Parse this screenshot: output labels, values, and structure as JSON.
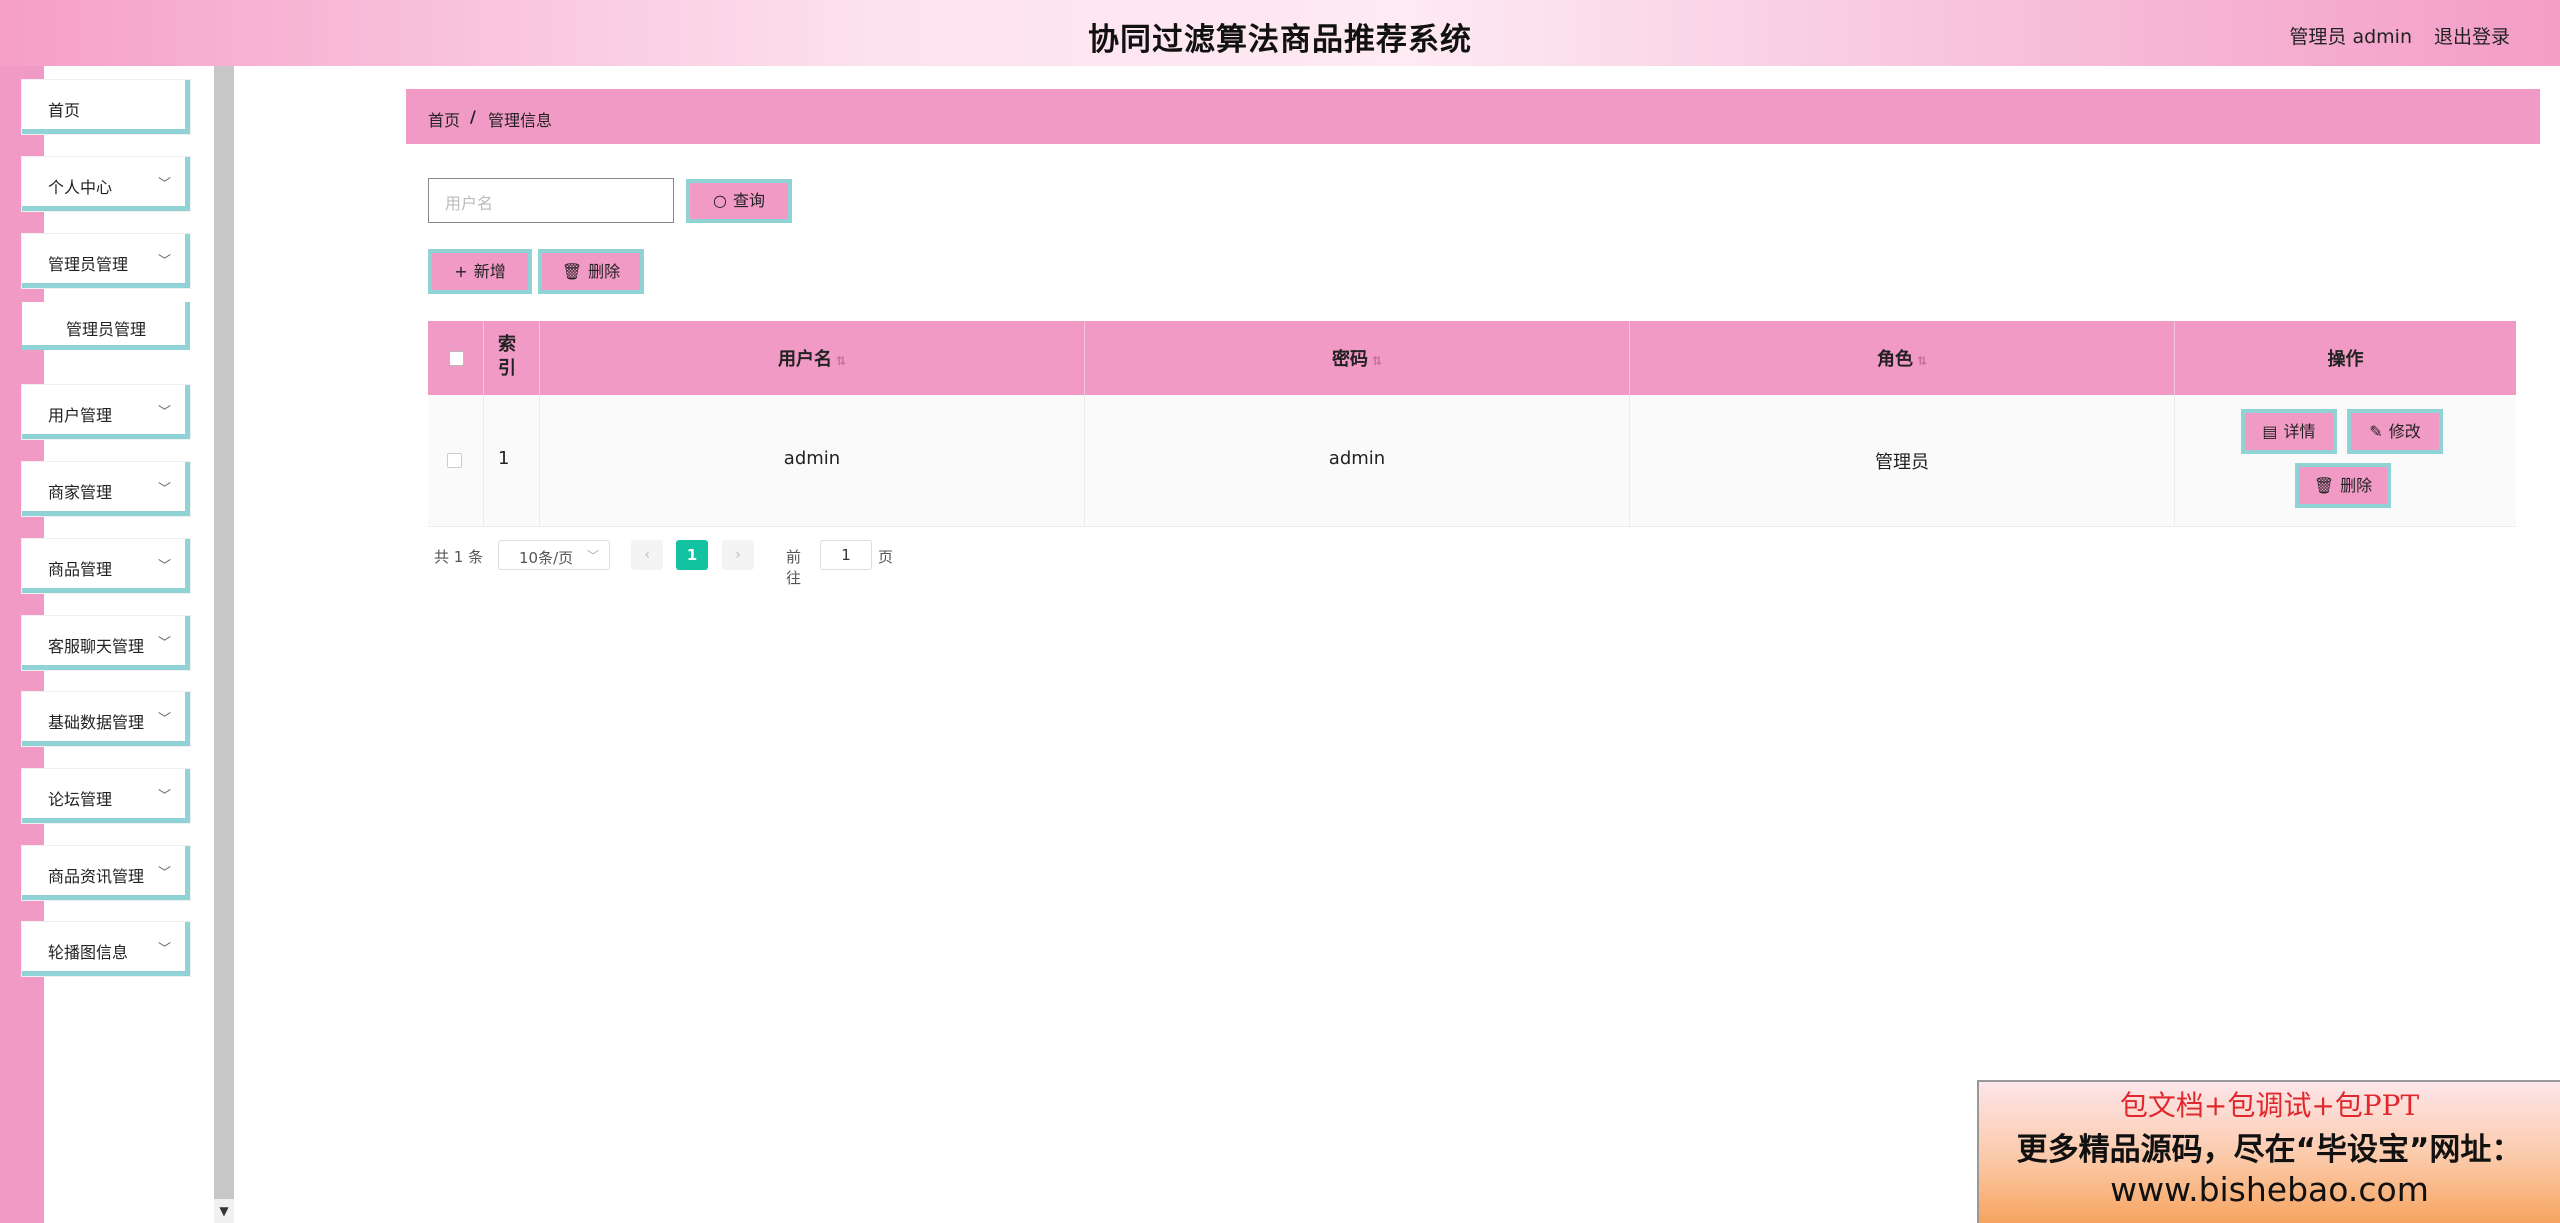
{
  "header": {
    "title": "协同过滤算法商品推荐系统",
    "user_label": "管理员 admin",
    "logout_label": "退出登录"
  },
  "sidebar": {
    "items": [
      {
        "label": "首页"
      },
      {
        "label": "个人中心"
      },
      {
        "label": "管理员管理"
      },
      {
        "label": "管理员管理"
      },
      {
        "label": "用户管理"
      },
      {
        "label": "商家管理"
      },
      {
        "label": "商品管理"
      },
      {
        "label": "客服聊天管理"
      },
      {
        "label": "基础数据管理"
      },
      {
        "label": "论坛管理"
      },
      {
        "label": "商品资讯管理"
      },
      {
        "label": "轮播图信息"
      }
    ]
  },
  "breadcrumb": {
    "home": "首页",
    "sep": "/",
    "current": "管理信息"
  },
  "search": {
    "placeholder": "用户名",
    "button_label": "查询"
  },
  "actions": {
    "add_label": "新增",
    "delete_label": "删除"
  },
  "table": {
    "headers": {
      "index": "索引",
      "username": "用户名",
      "password": "密码",
      "role": "角色",
      "ops": "操作"
    },
    "rows": [
      {
        "index": "1",
        "username": "admin",
        "password": "admin",
        "role": "管理员",
        "detail_label": "详情",
        "edit_label": "修改",
        "delete_label": "删除"
      }
    ]
  },
  "pagination": {
    "total": "共 1 条",
    "page_size": "10条/页",
    "current_page": "1",
    "goto_label": "前往",
    "goto_value": "1",
    "page_suffix": "页"
  },
  "watermark": {
    "line1": "包文档+包调试+包PPT",
    "line2": "更多精品源码，尽在“毕设宝”网址：",
    "line3": "www.bishebao.com"
  },
  "colors": {
    "accent_pink": "#f29ac6",
    "accent_teal": "#8fd3d6",
    "pager_active": "#13c2a0"
  }
}
